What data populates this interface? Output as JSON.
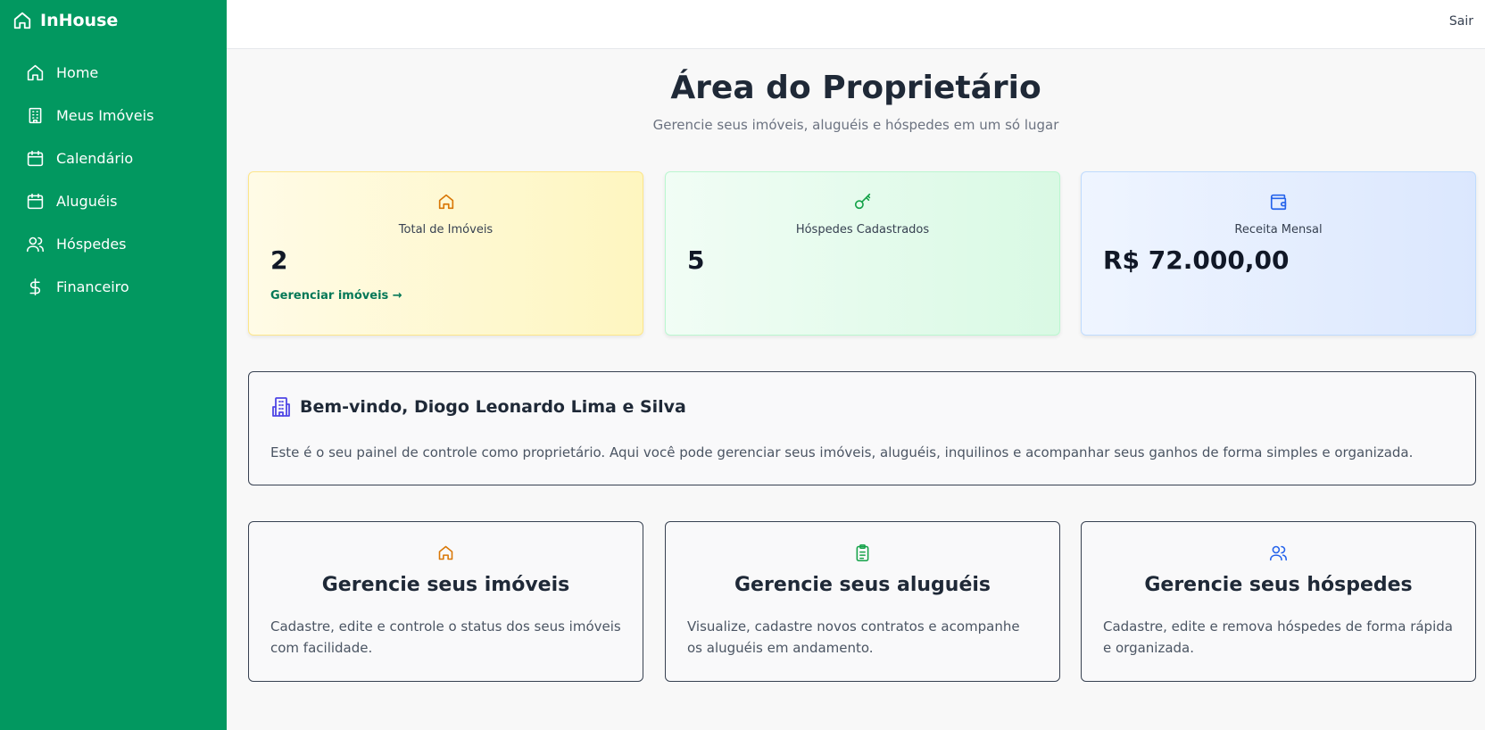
{
  "app": {
    "brand": "InHouse",
    "logout_label": "Sair"
  },
  "sidebar": {
    "items": [
      {
        "label": "Home",
        "icon": "home-icon"
      },
      {
        "label": "Meus Imóveis",
        "icon": "building-icon"
      },
      {
        "label": "Calendário",
        "icon": "calendar-icon"
      },
      {
        "label": "Aluguéis",
        "icon": "calendar-icon"
      },
      {
        "label": "Hóspedes",
        "icon": "users-icon"
      },
      {
        "label": "Financeiro",
        "icon": "dollar-icon"
      }
    ]
  },
  "header": {
    "title": "Área do Proprietário",
    "subtitle": "Gerencie seus imóveis, aluguéis e hóspedes em um só lugar"
  },
  "stats": [
    {
      "label": "Total de Imóveis",
      "value": "2",
      "link": "Gerenciar imóveis →",
      "icon": "home-icon",
      "color": "#d97706"
    },
    {
      "label": "Hóspedes Cadastrados",
      "value": "5",
      "icon": "key-icon",
      "color": "#16a34a"
    },
    {
      "label": "Receita Mensal",
      "value": "R$ 72.000,00",
      "icon": "wallet-icon",
      "color": "#2563eb"
    }
  ],
  "welcome": {
    "title": "Bem-vindo, Diogo Leonardo Lima e Silva",
    "text": "Este é o seu painel de controle como proprietário. Aqui você pode gerenciar seus imóveis, aluguéis, inquilinos e acompanhar seus ganhos de forma simples e organizada.",
    "icon": "building-icon",
    "icon_color": "#4f46e5"
  },
  "features": [
    {
      "title": "Gerencie seus imóveis",
      "desc": "Cadastre, edite e controle o status dos seus imóveis com facilidade.",
      "icon": "home-icon",
      "color": "#d97706"
    },
    {
      "title": "Gerencie seus aluguéis",
      "desc": "Visualize, cadastre novos contratos e acompanhe os aluguéis em andamento.",
      "icon": "clipboard-icon",
      "color": "#16a34a"
    },
    {
      "title": "Gerencie seus hóspedes",
      "desc": "Cadastre, edite e remova hóspedes de forma rápida e organizada.",
      "icon": "users-icon",
      "color": "#2563eb"
    }
  ],
  "colors": {
    "sidebar": "#029860",
    "accent_link": "#047857"
  }
}
